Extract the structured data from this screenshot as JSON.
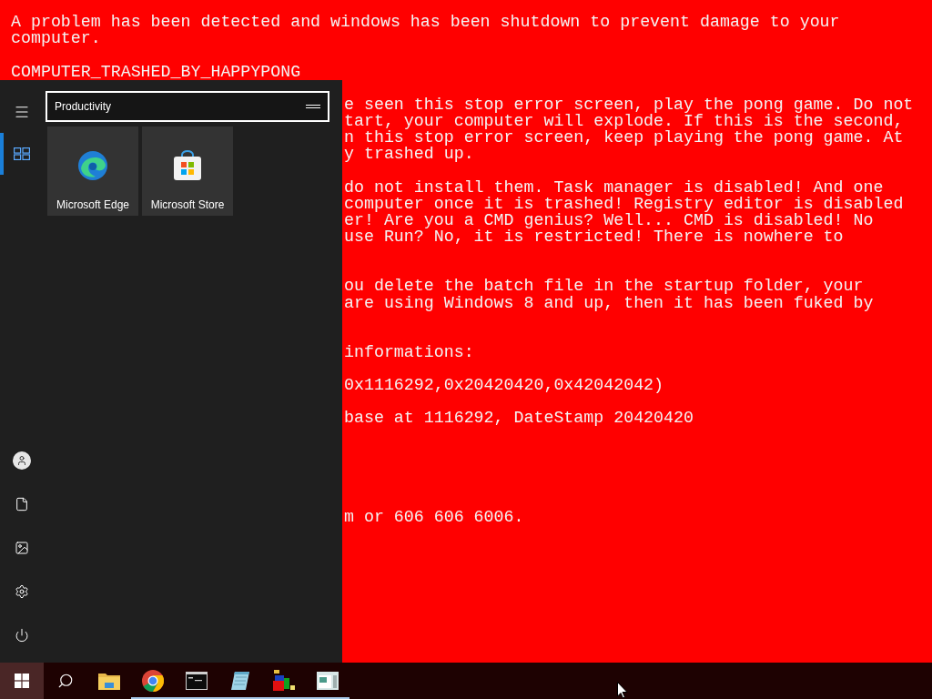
{
  "error_screen": {
    "header": [
      "A problem has been detected and windows has been shutdown to prevent damage to your",
      "computer."
    ],
    "code": "COMPUTER_TRASHED_BY_HAPPYPONG",
    "paragraphs": [
      [
        "e seen this stop error screen, play the pong game. Do not",
        "tart, your computer will explode. If this is the second,",
        "n this stop error screen, keep playing the pong game. At",
        "y trashed up."
      ],
      [
        "do not install them. Task manager is disabled! And one",
        "computer once it is trashed! Registry editor is disabled",
        "er! Are you a CMD genius? Well... CMD is disabled! No",
        "use Run? No, it is restricted! There is nowhere to"
      ],
      [
        "ou delete the batch file in the startup folder, your",
        "are using Windows 8 and up, then it has been fuked by"
      ],
      [
        "informations:"
      ],
      [
        "0x1116292,0x20420420,0x42042042)"
      ],
      [
        "base at 1116292, DateStamp 20420420"
      ],
      [
        "m or 606 606 6006."
      ]
    ]
  },
  "start_menu": {
    "open": true,
    "rail": [
      {
        "kind": "menu",
        "selected": false
      },
      {
        "kind": "tiles",
        "selected": true
      }
    ],
    "rail_bottom": [
      {
        "kind": "user"
      },
      {
        "kind": "documents"
      },
      {
        "kind": "pictures"
      },
      {
        "kind": "settings"
      },
      {
        "kind": "power"
      }
    ],
    "group": {
      "name": "Productivity"
    },
    "tiles": [
      {
        "kind": "edge",
        "label": "Microsoft Edge"
      },
      {
        "kind": "store",
        "label": "Microsoft Store"
      }
    ]
  },
  "taskbar": {
    "items": [
      {
        "kind": "start",
        "selected": true,
        "running": false
      },
      {
        "kind": "search",
        "selected": false,
        "running": false
      },
      {
        "kind": "folder",
        "selected": false,
        "running": false
      },
      {
        "kind": "chrome",
        "selected": false,
        "running": true
      },
      {
        "kind": "cmd",
        "selected": false,
        "running": true
      },
      {
        "kind": "notepad",
        "selected": false,
        "running": true
      },
      {
        "kind": "blocks",
        "selected": false,
        "running": true
      },
      {
        "kind": "window",
        "selected": false,
        "running": true
      }
    ]
  }
}
